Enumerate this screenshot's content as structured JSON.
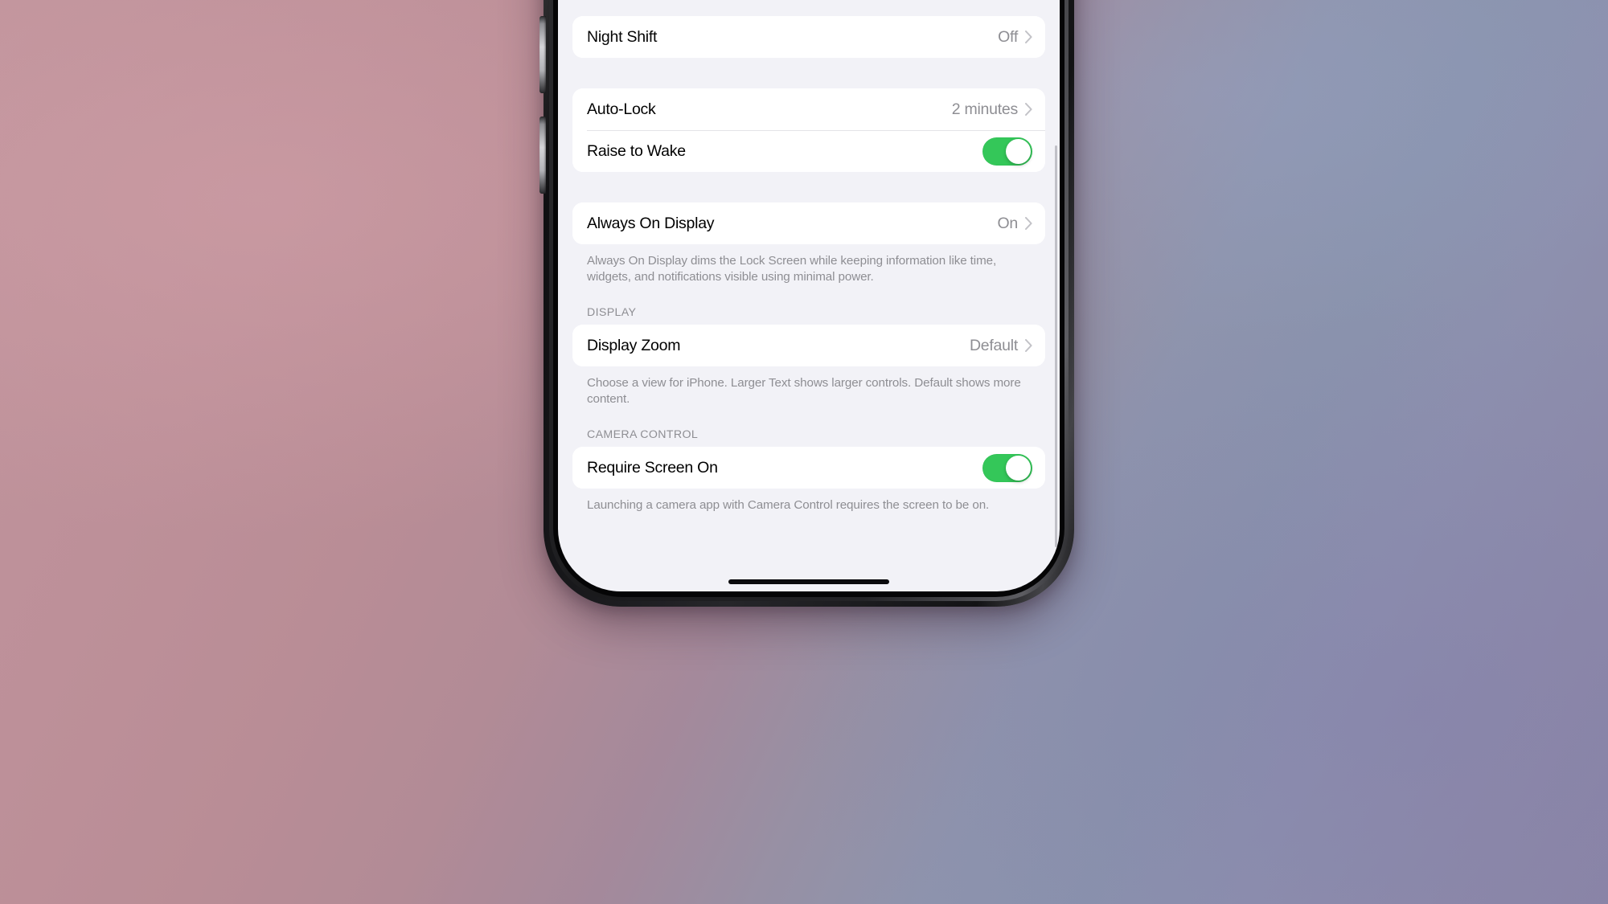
{
  "wallpaper": {
    "left_color": "#bd9099",
    "right_color": "#8c8dad"
  },
  "device": {
    "name": "iPhone",
    "frame_color": "#1c1c1e",
    "screen_background": "#f2f2f7",
    "buttons": [
      {
        "name": "volume-up",
        "label": "Volume Up"
      },
      {
        "name": "volume-down",
        "label": "Volume Down"
      }
    ],
    "home_indicator": "home-indicator"
  },
  "settings": {
    "accent_green": "#34c759",
    "value_color": "#8e8e93",
    "groups": [
      {
        "id": "night-shift-group",
        "rows": [
          {
            "type": "link",
            "label": "Night Shift",
            "value": "Off",
            "icon": "chevron-right-icon"
          }
        ]
      },
      {
        "id": "lock-group",
        "rows": [
          {
            "type": "link",
            "label": "Auto-Lock",
            "value": "2 minutes",
            "icon": "chevron-right-icon"
          },
          {
            "type": "toggle",
            "label": "Raise to Wake",
            "value": "on"
          }
        ]
      },
      {
        "id": "always-on-display-group",
        "rows": [
          {
            "type": "link",
            "label": "Always On Display",
            "value": "On",
            "icon": "chevron-right-icon"
          }
        ],
        "footnote": "Always On Display dims the Lock Screen while keeping information like time, widgets, and notifications visible using minimal power."
      },
      {
        "id": "display-group",
        "header": "DISPLAY",
        "rows": [
          {
            "type": "link",
            "label": "Display Zoom",
            "value": "Default",
            "icon": "chevron-right-icon"
          }
        ],
        "footnote": "Choose a view for iPhone. Larger Text shows larger controls. Default shows more content."
      },
      {
        "id": "camera-control-group",
        "header": "CAMERA CONTROL",
        "rows": [
          {
            "type": "toggle",
            "label": "Require Screen On",
            "value": "on"
          }
        ],
        "footnote": "Launching a camera app with Camera Control requires the screen to be on."
      }
    ]
  }
}
